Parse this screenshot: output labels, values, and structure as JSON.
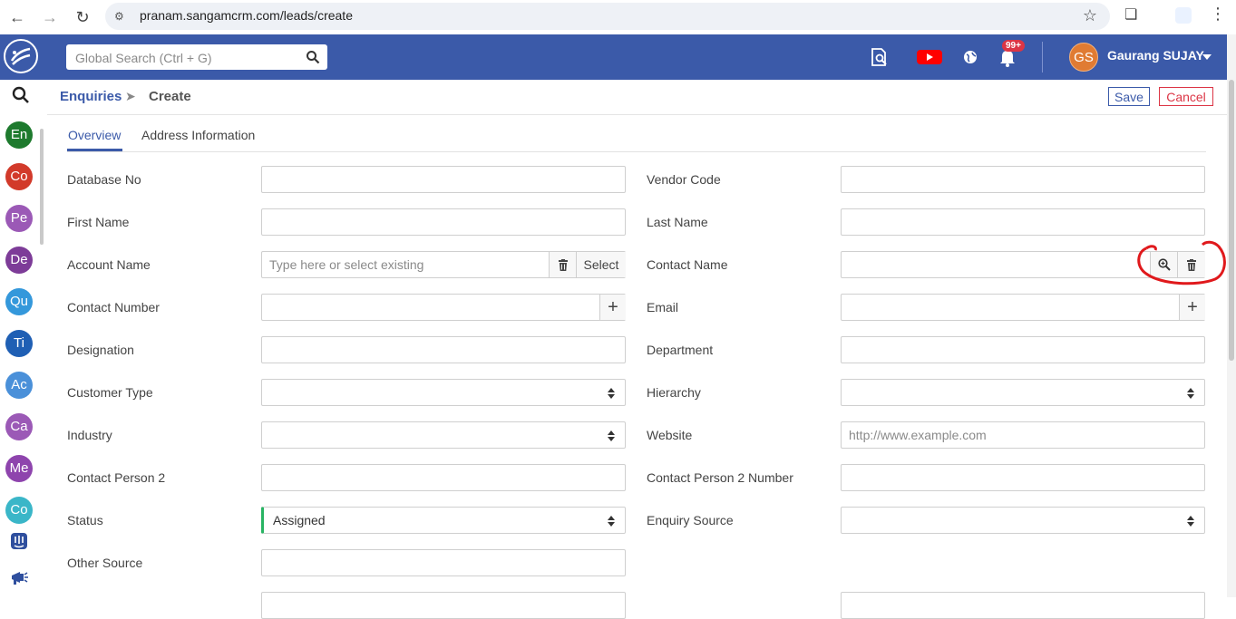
{
  "browser": {
    "url": "pranam.sangamcrm.com/leads/create"
  },
  "header": {
    "search_placeholder": "Global Search (Ctrl + G)",
    "notification_badge": "99+",
    "user_initials": "GS",
    "user_name": "Gaurang SUJAY"
  },
  "sidebar": {
    "modules": [
      {
        "label": "En",
        "color": "#1e7a2e"
      },
      {
        "label": "Co",
        "color": "#d23a2a"
      },
      {
        "label": "Pe",
        "color": "#9b59b6"
      },
      {
        "label": "De",
        "color": "#7d3c98"
      },
      {
        "label": "Qu",
        "color": "#3498db"
      },
      {
        "label": "Ti",
        "color": "#1f5fb4"
      },
      {
        "label": "Ac",
        "color": "#4a90d9"
      },
      {
        "label": "Ca",
        "color": "#9b59b6"
      },
      {
        "label": "Me",
        "color": "#8e44ad"
      },
      {
        "label": "Co",
        "color": "#3ab6c8"
      }
    ]
  },
  "breadcrumb": {
    "module": "Enquiries",
    "page": "Create"
  },
  "actions": {
    "save": "Save",
    "cancel": "Cancel"
  },
  "tabs": [
    "Overview",
    "Address Information"
  ],
  "form": {
    "left": [
      {
        "label": "Database No"
      },
      {
        "label": "First Name"
      },
      {
        "label": "Account Name",
        "placeholder": "Type here or select existing",
        "select_label": "Select"
      },
      {
        "label": "Contact Number"
      },
      {
        "label": "Designation"
      },
      {
        "label": "Customer Type"
      },
      {
        "label": "Industry"
      },
      {
        "label": "Contact Person 2"
      },
      {
        "label": "Status",
        "value": "Assigned"
      },
      {
        "label": "Other Source"
      }
    ],
    "right": [
      {
        "label": "Vendor Code"
      },
      {
        "label": "Last Name"
      },
      {
        "label": "Contact Name"
      },
      {
        "label": "Email"
      },
      {
        "label": "Department"
      },
      {
        "label": "Hierarchy"
      },
      {
        "label": "Website",
        "placeholder": "http://www.example.com"
      },
      {
        "label": "Contact Person 2 Number"
      },
      {
        "label": "Enquiry Source"
      }
    ]
  },
  "colors": {
    "brand": "#3b5aa9",
    "danger": "#dc3545",
    "annotation": "#e0191c"
  }
}
